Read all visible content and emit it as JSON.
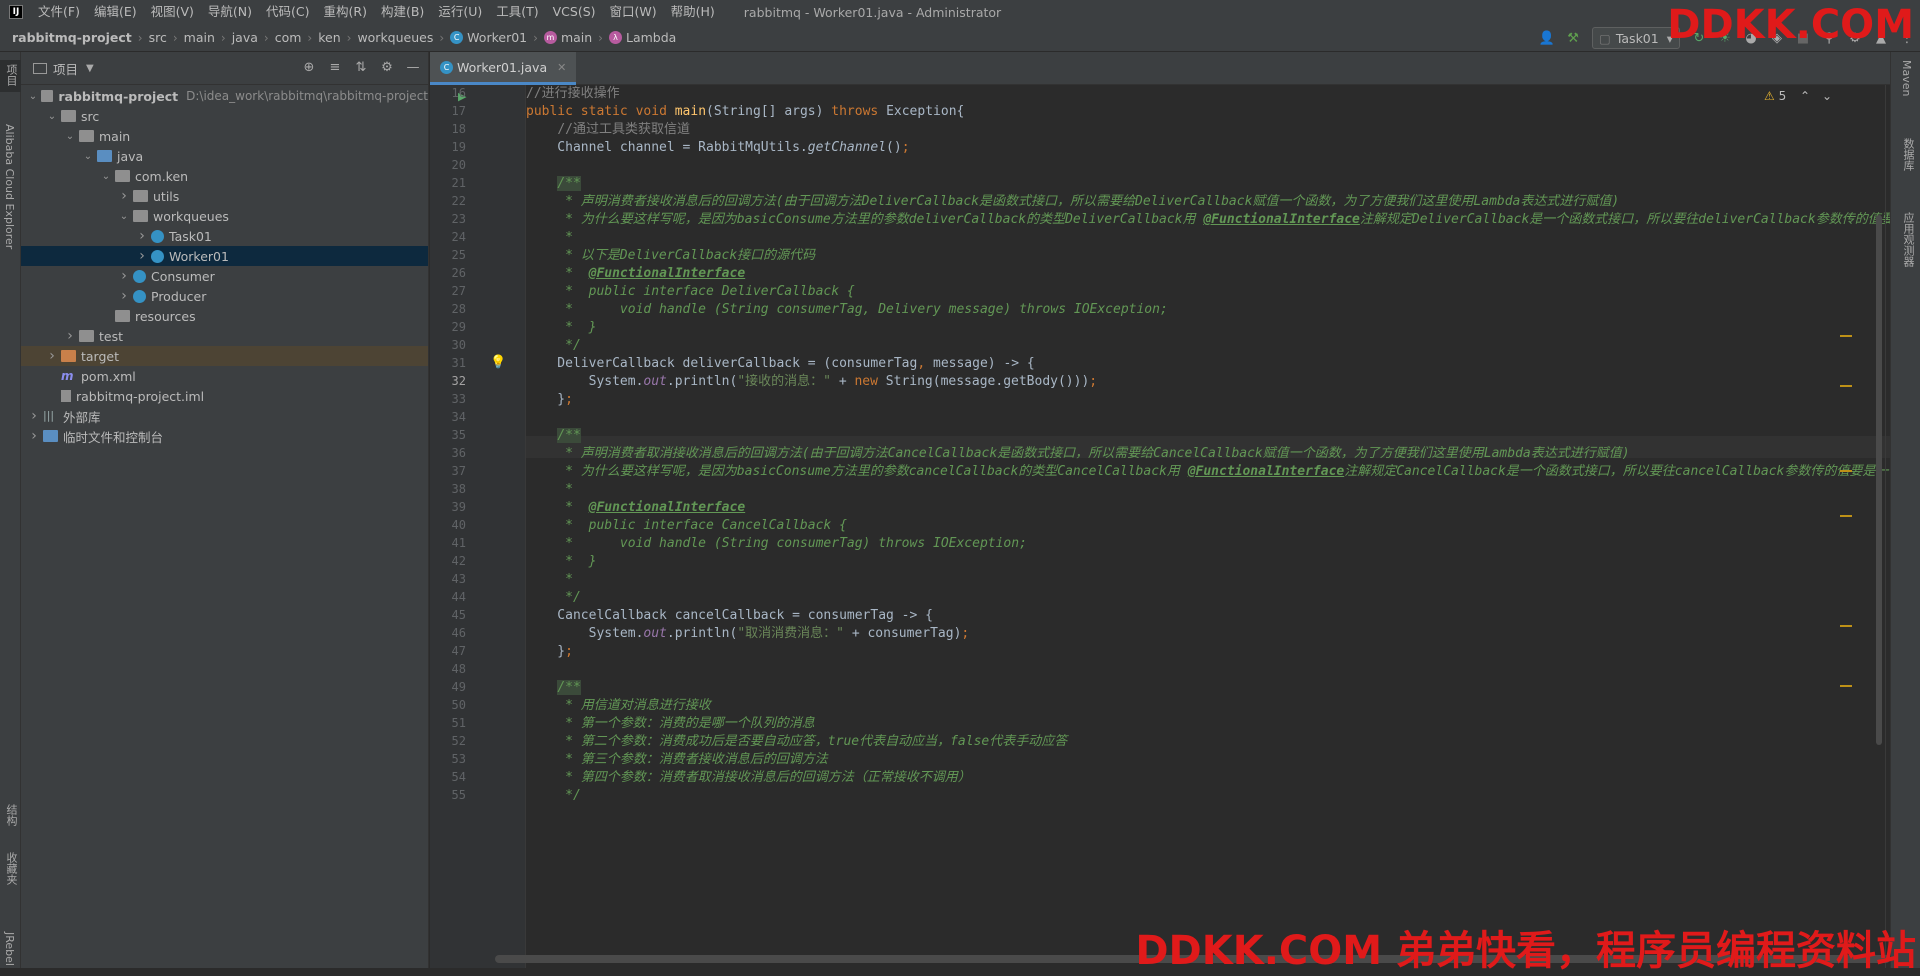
{
  "menubar": {
    "items": [
      "文件(F)",
      "编辑(E)",
      "视图(V)",
      "导航(N)",
      "代码(C)",
      "重构(R)",
      "构建(B)",
      "运行(U)",
      "工具(T)",
      "VCS(S)",
      "窗口(W)",
      "帮助(H)"
    ],
    "window_title": "rabbitmq - Worker01.java - Administrator"
  },
  "breadcrumb": {
    "items": [
      "rabbitmq-project",
      "src",
      "main",
      "java",
      "com",
      "ken",
      "workqueues",
      "Worker01",
      "main",
      "Lambda"
    ]
  },
  "toolbar": {
    "run_config": "Task01"
  },
  "project_panel": {
    "title": "项目",
    "tree": [
      {
        "label": "rabbitmq-project",
        "path": "D:\\idea_work\\rabbitmq\\rabbitmq-project",
        "depth": 0,
        "expanded": true,
        "icon": "folder"
      },
      {
        "label": "src",
        "depth": 1,
        "expanded": true,
        "icon": "folder"
      },
      {
        "label": "main",
        "depth": 2,
        "expanded": true,
        "icon": "folder"
      },
      {
        "label": "java",
        "depth": 3,
        "expanded": true,
        "icon": "folder-blue"
      },
      {
        "label": "com.ken",
        "depth": 4,
        "expanded": true,
        "icon": "folder"
      },
      {
        "label": "utils",
        "depth": 5,
        "expanded": false,
        "icon": "folder"
      },
      {
        "label": "workqueues",
        "depth": 5,
        "expanded": true,
        "icon": "folder"
      },
      {
        "label": "Task01",
        "depth": 6,
        "expanded": false,
        "icon": "java-class"
      },
      {
        "label": "Worker01",
        "depth": 6,
        "expanded": false,
        "icon": "java-class",
        "selected": true
      },
      {
        "label": "Consumer",
        "depth": 5,
        "expanded": false,
        "icon": "java-class"
      },
      {
        "label": "Producer",
        "depth": 5,
        "expanded": false,
        "icon": "java-class"
      },
      {
        "label": "resources",
        "depth": 4,
        "icon": "folder"
      },
      {
        "label": "test",
        "depth": 2,
        "expanded": false,
        "icon": "folder"
      },
      {
        "label": "target",
        "depth": 1,
        "expanded": false,
        "icon": "folder-orange",
        "highlight": true
      },
      {
        "label": "pom.xml",
        "depth": 1,
        "icon": "maven"
      },
      {
        "label": "rabbitmq-project.iml",
        "depth": 1,
        "icon": "iml"
      },
      {
        "label": "外部库",
        "depth": 0,
        "expanded": false,
        "icon": "library"
      },
      {
        "label": "临时文件和控制台",
        "depth": 0,
        "expanded": false,
        "icon": "scratch"
      }
    ]
  },
  "left_strip": {
    "top_labels": [
      "项目",
      "Alibaba Cloud Explorer"
    ],
    "bottom_labels": [
      "结构",
      "收藏夹",
      "JRebel"
    ]
  },
  "right_strip": {
    "labels": [
      "Maven",
      "数据库",
      "应用观测器"
    ]
  },
  "editor": {
    "tab": "Worker01.java",
    "warnings": "5",
    "current_line": 32,
    "line_numbers": [
      "16",
      "17",
      "18",
      "19",
      "20",
      "21",
      "22",
      "23",
      "24",
      "25",
      "26",
      "27",
      "28",
      "29",
      "30",
      "31",
      "32",
      "33",
      "34",
      "35",
      "36",
      "37",
      "38",
      "39",
      "40",
      "41",
      "42",
      "43",
      "44",
      "45",
      "46",
      "47",
      "48",
      "49",
      "50",
      "51",
      "52",
      "53",
      "54",
      "55"
    ],
    "lines": [
      "//进行接收操作",
      "public static void main(String[] args) throws Exception{",
      "    //通过工具类获取信道",
      "    Channel channel = RabbitMqUtils.getChannel();",
      "",
      "    /**",
      "     * 声明消费者接收消息后的回调方法(由于回调方法DeliverCallback是函数式接口，所以需要给DeliverCallback赋值一个函数，为了方便我们这里使用Lambda表达式进行赋值)",
      "     * 为什么要这样写呢，是因为basicConsume方法里的参数deliverCallback的类型DeliverCallback用 @FunctionalInterface注解规定DeliverCallback是一个函数式接口，所以要往deliverCallback参数传的值要是一个函数",
      "     *",
      "     * 以下是DeliverCallback接口的源代码",
      "     *  @FunctionalInterface",
      "     *  public interface DeliverCallback {",
      "     *      void handle (String consumerTag, Delivery message) throws IOException;",
      "     *  }",
      "     */",
      "    DeliverCallback deliverCallback = (consumerTag, message) -> {",
      "        System.out.println(\"接收的消息：\" + new String(message.getBody()));",
      "    };",
      "",
      "    /**",
      "     * 声明消费者取消接收消息后的回调方法(由于回调方法CancelCallback是函数式接口，所以需要给CancelCallback赋值一个函数，为了方便我们这里使用Lambda表达式进行赋值)",
      "     * 为什么要这样写呢，是因为basicConsume方法里的参数cancelCallback的类型CancelCallback用 @FunctionalInterface注解规定CancelCallback是一个函数式接口，所以要往cancelCallback参数传的值要是一个函数",
      "     *",
      "     *  @FunctionalInterface",
      "     *  public interface CancelCallback {",
      "     *      void handle (String consumerTag) throws IOException;",
      "     *  }",
      "     *",
      "     */",
      "    CancelCallback cancelCallback = consumerTag -> {",
      "        System.out.println(\"取消消费消息：\" + consumerTag);",
      "    };",
      "",
      "    /**",
      "     * 用信道对消息进行接收",
      "     * 第一个参数：消费的是哪一个队列的消息",
      "     * 第二个参数：消费成功后是否要自动应答，true代表自动应当，false代表手动应答",
      "     * 第三个参数：消费者接收消息后的回调方法",
      "     * 第四个参数：消费者取消接收消息后的回调方法（正常接收不调用）",
      "     */"
    ]
  },
  "watermark": {
    "top": "DDKK.COM",
    "bottom": "DDKK.COM 弟弟快看，程序员编程资料站"
  },
  "colors": {
    "accent": "#4a88c7",
    "selection": "#0d293e",
    "watermark": "#e01a1a"
  }
}
